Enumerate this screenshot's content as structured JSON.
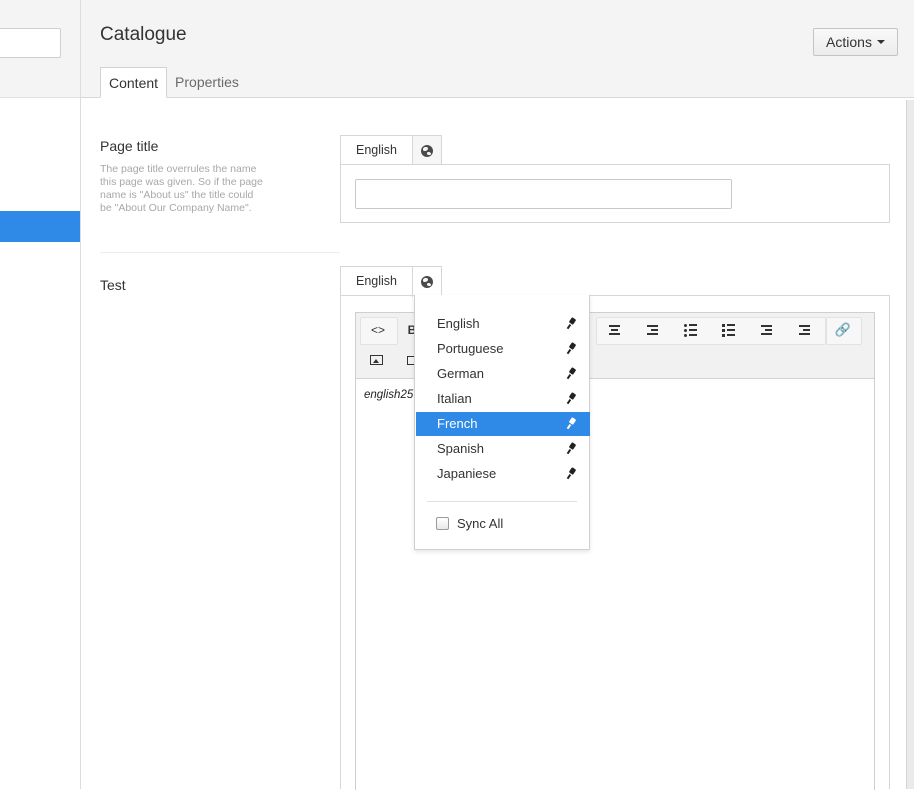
{
  "header": {
    "page_name": "Catalogue",
    "actions_label": "Actions",
    "tabs": [
      {
        "label": "Content",
        "active": true
      },
      {
        "label": "Properties",
        "active": false
      }
    ]
  },
  "properties": [
    {
      "label": "Page title",
      "description": "The page title overrules the name this page was given. So if the page name is \"About us\" the title could be \"About Our Company Name\".",
      "language_tab": "English",
      "value": ""
    },
    {
      "label": "Test",
      "language_tab": "English",
      "editor_content": "english25"
    }
  ],
  "editor_toolbar": {
    "icons": [
      "code-icon",
      "bold-icon",
      "format-icon",
      "align-center-icon",
      "align-right-icon",
      "bullet-list-icon",
      "numbered-list-icon",
      "outdent-icon",
      "indent-icon",
      "link-icon",
      "image-icon",
      "media-icon"
    ]
  },
  "language_dropdown": {
    "items": [
      {
        "label": "English",
        "selected": false
      },
      {
        "label": "Portuguese",
        "selected": false
      },
      {
        "label": "German",
        "selected": false
      },
      {
        "label": "Italian",
        "selected": false
      },
      {
        "label": "French",
        "selected": true
      },
      {
        "label": "Spanish",
        "selected": false
      },
      {
        "label": "Japaniese",
        "selected": false
      }
    ],
    "sync_label": "Sync All",
    "sync_checked": false
  },
  "colors": {
    "accent": "#2e8ae6",
    "header_bg": "#f4f4f4"
  }
}
